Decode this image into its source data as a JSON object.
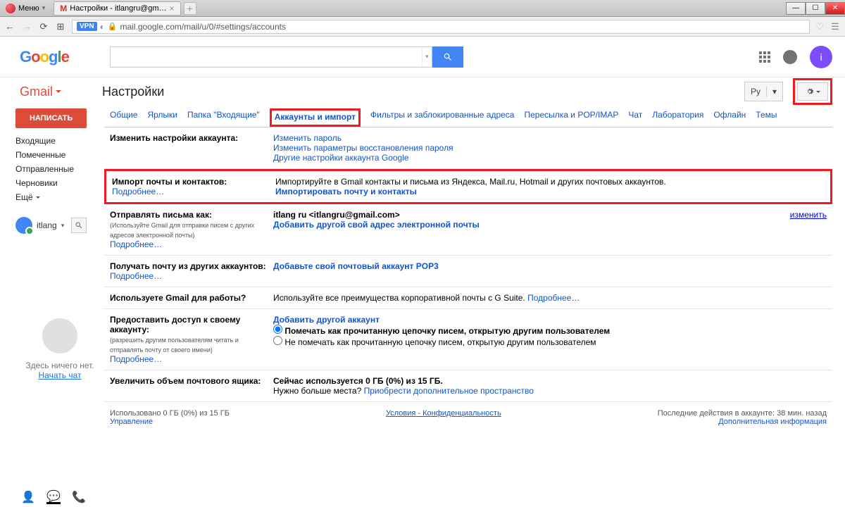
{
  "browser": {
    "menu": "Меню",
    "tab_title": "Настройки - itlangru@gm…",
    "url": "mail.google.com/mail/u/0/#settings/accounts",
    "vpn": "VPN"
  },
  "google_bar": {
    "avatar_letter": "i"
  },
  "header": {
    "gmail": "Gmail",
    "title": "Настройки",
    "lang": "Ру"
  },
  "sidebar": {
    "compose": "НАПИСАТЬ",
    "items": [
      "Входящие",
      "Помеченные",
      "Отправленные",
      "Черновики"
    ],
    "more": "Ещё",
    "user": "itlang",
    "hangout_empty": "Здесь ничего нет.",
    "hangout_start": "Начать чат"
  },
  "tabs": [
    "Общие",
    "Ярлыки",
    "Папка \"Входящие\"",
    "Аккаунты и импорт",
    "Фильтры и заблокированные адреса",
    "Пересылка и POP/IMAP",
    "Чат",
    "Лаборатория",
    "Офлайн",
    "Темы"
  ],
  "rows": {
    "account_change": {
      "label": "Изменить настройки аккаунта:",
      "links": [
        "Изменить пароль",
        "Изменить параметры восстановления пароля",
        "Другие настройки аккаунта Google"
      ]
    },
    "import": {
      "label": "Импорт почты и контактов:",
      "learn": "Подробнее…",
      "desc": "Импортируйте в Gmail контакты и письма из Яндекса, Mail.ru, Hotmail и других почтовых аккаунтов.",
      "action": "Импортировать почту и контакты"
    },
    "send_as": {
      "label": "Отправлять письма как:",
      "sub": "(Используйте Gmail для отправки писем с других адресов электронной почты)",
      "learn": "Подробнее…",
      "identity": "itlang ru <itlangru@gmail.com>",
      "add": "Добавить другой свой адрес электронной почты",
      "change": "изменить"
    },
    "check_mail": {
      "label": "Получать почту из других аккаунтов:",
      "learn": "Подробнее…",
      "add": "Добавьте свой почтовый аккаунт POP3"
    },
    "work": {
      "label": "Используете Gmail для работы?",
      "desc": "Используйте все преимущества корпоративной почты с G Suite.",
      "learn": "Подробнее…"
    },
    "grant": {
      "label": "Предоставить доступ к своему аккаунту:",
      "sub": "(разрешить другим пользователям читать и отправлять почту от своего имени)",
      "learn": "Подробнее…",
      "add": "Добавить другой аккаунт",
      "opt1": "Помечать как прочитанную цепочку писем, открытую другим пользователем",
      "opt2": "Не помечать как прочитанную цепочку писем, открытую другим пользователем"
    },
    "storage": {
      "label": "Увеличить объем почтового ящика:",
      "desc": "Сейчас используется 0 ГБ (0%) из 15 ГБ.",
      "more_text": "Нужно больше места?",
      "more_link": "Приобрести дополнительное пространство"
    }
  },
  "footer": {
    "used": "Использовано 0 ГБ (0%) из 15 ГБ",
    "manage": "Управление",
    "terms": "Условия",
    "privacy": "Конфиденциальность",
    "activity": "Последние действия в аккаунте: 38 мин. назад",
    "details": "Дополнительная информация"
  }
}
